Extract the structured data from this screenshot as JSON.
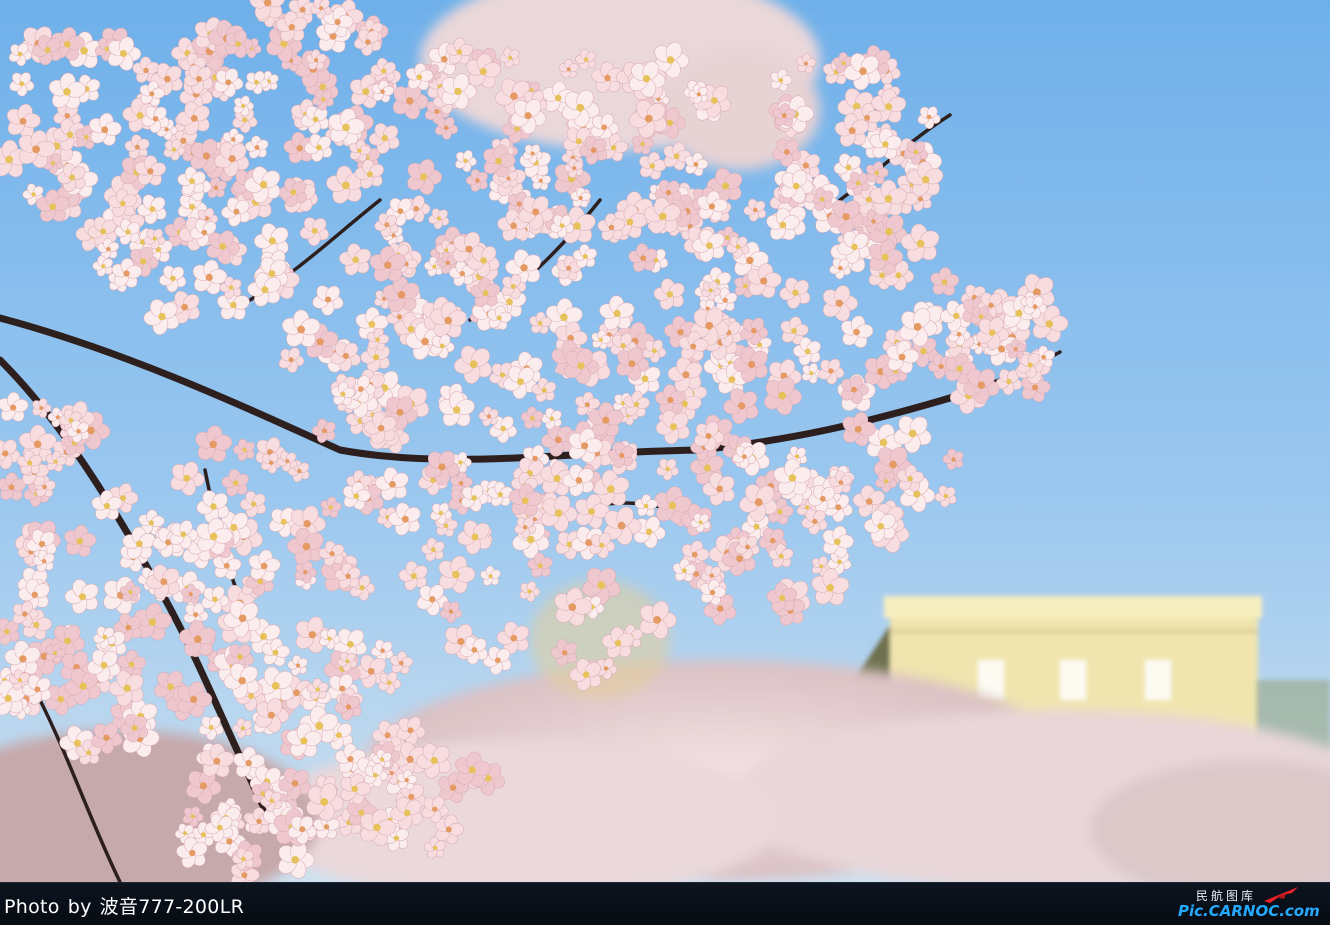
{
  "photo": {
    "subject": "cherry blossom branches",
    "colors": {
      "sky_top": "#74b3ea",
      "sky_bottom": "#bcd8ef",
      "blossom": "#f7dde0",
      "blossom_center": "#e49a62",
      "branch": "#2e1f1f",
      "building": "#f0e3ad"
    }
  },
  "footer": {
    "credit_prefix": "Photo",
    "credit_by": "by",
    "credit_author": "波音777-200LR",
    "watermark_cn": "民航图库",
    "watermark_site": "Pic.CARNOC.com",
    "watermark_icon": "plane-icon"
  }
}
